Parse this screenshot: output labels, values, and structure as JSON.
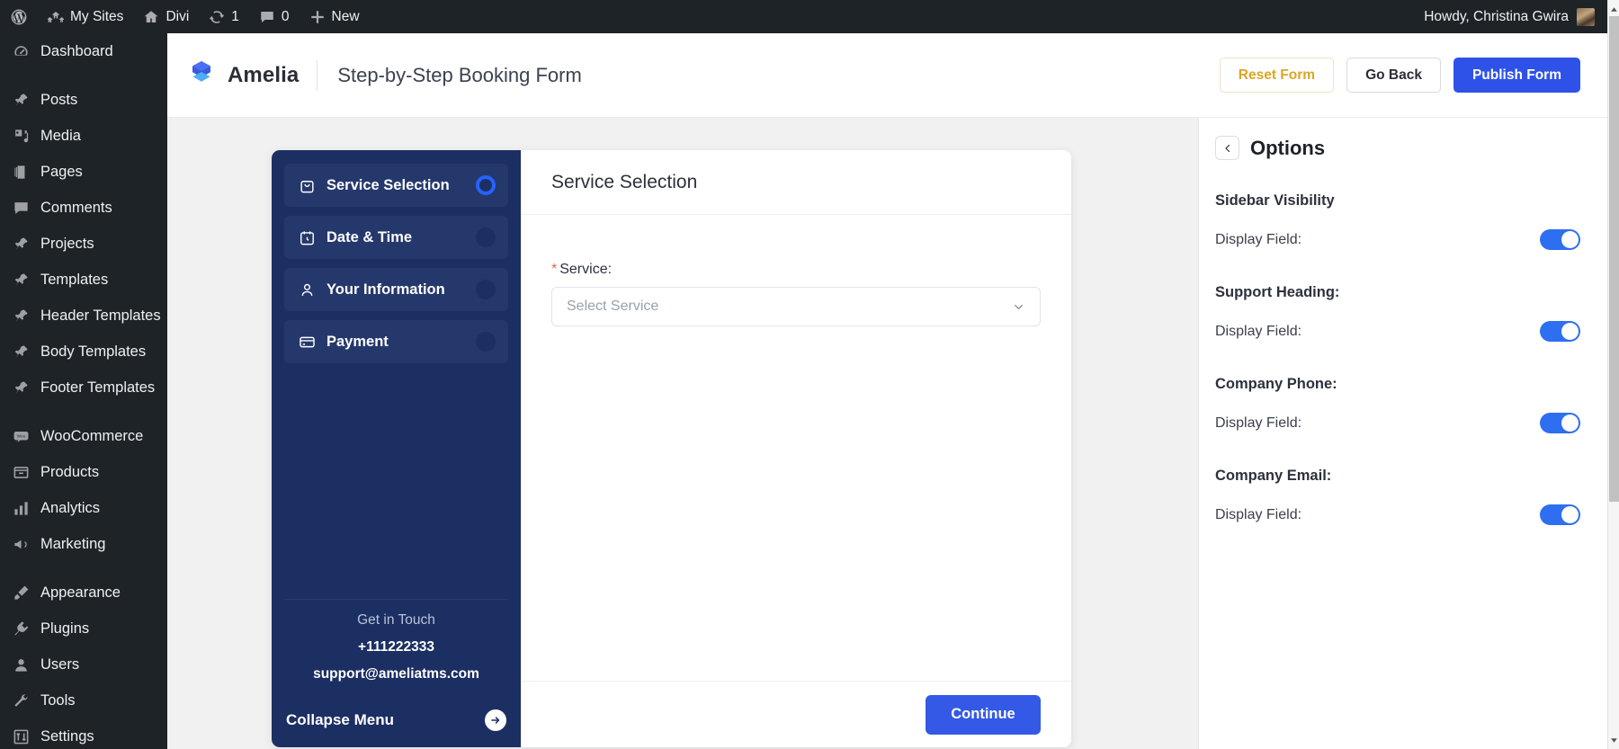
{
  "adminbar": {
    "items": [
      {
        "icon": "wordpress-icon",
        "label": ""
      },
      {
        "icon": "sites-icon",
        "label": "My Sites"
      },
      {
        "icon": "home-icon",
        "label": "Divi"
      },
      {
        "icon": "updates-icon",
        "label": "1"
      },
      {
        "icon": "comments-icon",
        "label": "0"
      },
      {
        "icon": "plus-icon",
        "label": "New"
      }
    ],
    "howdy": "Howdy, Christina Gwira"
  },
  "wp_sidebar": {
    "items": [
      {
        "label": "Dashboard",
        "icon": "dashboard-icon",
        "sep_after": true
      },
      {
        "label": "Posts",
        "icon": "pin-icon"
      },
      {
        "label": "Media",
        "icon": "media-icon"
      },
      {
        "label": "Pages",
        "icon": "pages-icon"
      },
      {
        "label": "Comments",
        "icon": "comments-icon"
      },
      {
        "label": "Projects",
        "icon": "pin-icon"
      },
      {
        "label": "Templates",
        "icon": "pin-icon"
      },
      {
        "label": "Header Templates",
        "icon": "pin-icon"
      },
      {
        "label": "Body Templates",
        "icon": "pin-icon"
      },
      {
        "label": "Footer Templates",
        "icon": "pin-icon",
        "sep_after": true
      },
      {
        "label": "WooCommerce",
        "icon": "woo-icon"
      },
      {
        "label": "Products",
        "icon": "products-icon"
      },
      {
        "label": "Analytics",
        "icon": "analytics-icon"
      },
      {
        "label": "Marketing",
        "icon": "marketing-icon",
        "sep_after": true
      },
      {
        "label": "Appearance",
        "icon": "appearance-icon"
      },
      {
        "label": "Plugins",
        "icon": "plugins-icon"
      },
      {
        "label": "Users",
        "icon": "users-icon"
      },
      {
        "label": "Tools",
        "icon": "tools-icon"
      },
      {
        "label": "Settings",
        "icon": "settings-icon"
      }
    ]
  },
  "header": {
    "brand_name": "Amelia",
    "form_title": "Step-by-Step Booking Form",
    "reset_label": "Reset Form",
    "goback_label": "Go Back",
    "publish_label": "Publish Form"
  },
  "booking": {
    "steps": [
      {
        "label": "Service Selection",
        "icon": "bag-icon",
        "active": true
      },
      {
        "label": "Date & Time",
        "icon": "calendar-clock-icon",
        "active": false
      },
      {
        "label": "Your Information",
        "icon": "person-icon",
        "active": false
      },
      {
        "label": "Payment",
        "icon": "card-icon",
        "active": false
      }
    ],
    "support_heading": "Get in Touch",
    "company_phone": "+111222333",
    "company_email": "support@ameliatms.com",
    "collapse_label": "Collapse Menu",
    "panel_title": "Service Selection",
    "service_label": "Service:",
    "service_required_mark": "*",
    "service_placeholder": "Select Service",
    "continue_label": "Continue"
  },
  "options": {
    "title": "Options",
    "groups": [
      {
        "title": "Sidebar Visibility",
        "row_label": "Display Field:",
        "value": "on"
      },
      {
        "title": "Support Heading:",
        "row_label": "Display Field:",
        "value": "on"
      },
      {
        "title": "Company Phone:",
        "row_label": "Display Field:",
        "value": "on"
      },
      {
        "title": "Company Email:",
        "row_label": "Display Field:",
        "value": "on"
      }
    ]
  },
  "colors": {
    "accent_blue": "#2e52e8",
    "sidebar_navy": "#1c2f63",
    "wp_dark": "#1d2327",
    "reset_yellow": "#d9a625",
    "required_red": "#e06a47"
  }
}
